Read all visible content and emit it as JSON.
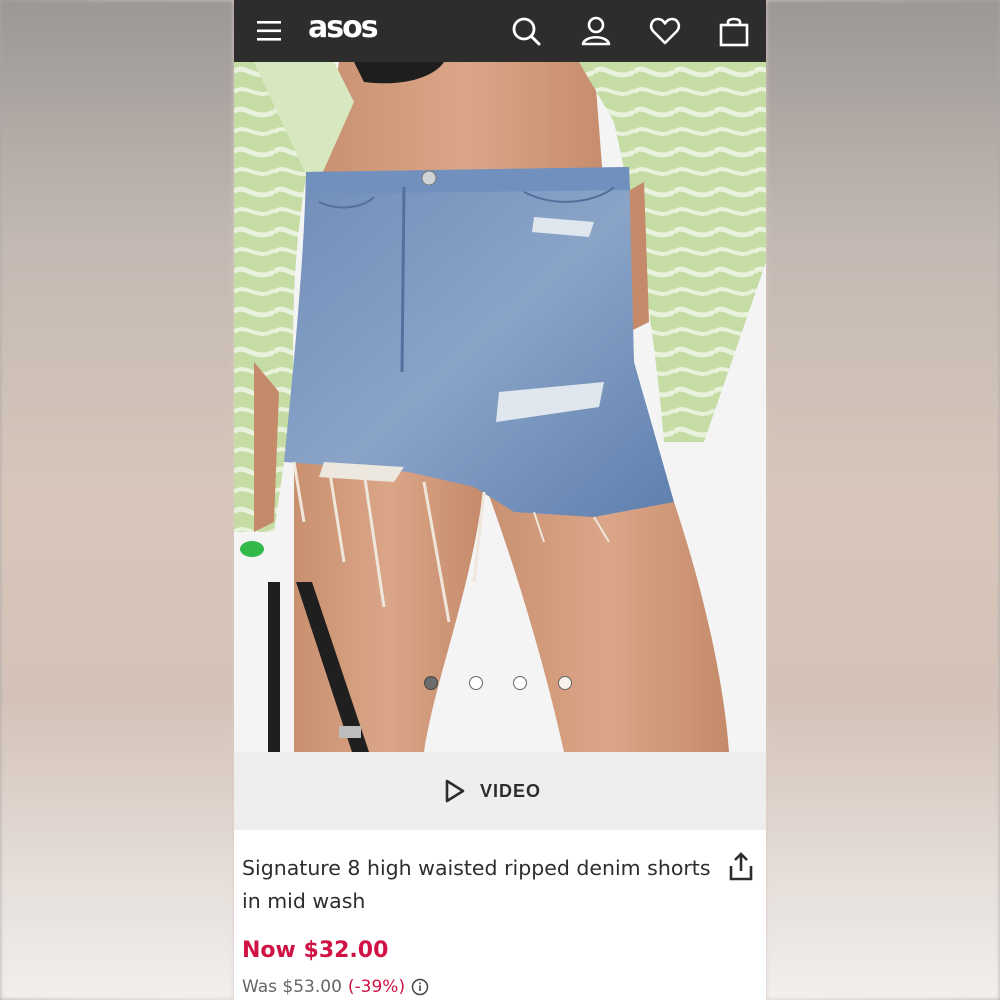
{
  "header": {
    "brand": "asos",
    "icons": [
      "menu-icon",
      "search-icon",
      "account-icon",
      "heart-icon",
      "bag-icon"
    ]
  },
  "gallery": {
    "image_count": 4,
    "active_index": 0
  },
  "video": {
    "label": "VIDEO"
  },
  "product": {
    "title": "Signature 8 high waisted ripped denim shorts in mid wash",
    "price_now": "Now $32.00",
    "price_was_label": "Was $53.00",
    "discount": "(-39%)"
  },
  "colors": {
    "header_bg": "#2d2d2d",
    "sale_red": "#d01345",
    "denim": "#6f8db8",
    "shirt_green": "#c5dca4"
  }
}
